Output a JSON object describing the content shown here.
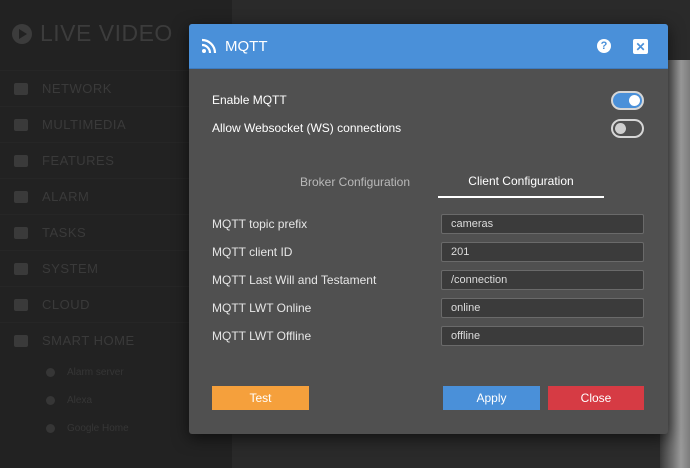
{
  "background": {
    "app_title": "LIVE VIDEO",
    "menu": [
      {
        "label": "NETWORK",
        "icon": "network-icon"
      },
      {
        "label": "MULTIMEDIA",
        "icon": "image-icon"
      },
      {
        "label": "FEATURES",
        "icon": "features-icon"
      },
      {
        "label": "ALARM",
        "icon": "bell-icon"
      },
      {
        "label": "TASKS",
        "icon": "tasks-icon"
      },
      {
        "label": "SYSTEM",
        "icon": "gear-icon"
      },
      {
        "label": "CLOUD",
        "icon": "cloud-icon"
      },
      {
        "label": "SMART HOME",
        "icon": "home-icon"
      }
    ],
    "submenu": [
      {
        "label": "Alarm server",
        "icon": "server-icon"
      },
      {
        "label": "Alexa",
        "icon": "alexa-icon"
      },
      {
        "label": "Google Home",
        "icon": "google-icon"
      }
    ]
  },
  "dialog": {
    "title": "MQTT",
    "header_icon": "rss-icon",
    "help_label": "?",
    "close_x_label": "✕",
    "toggles": [
      {
        "label": "Enable MQTT",
        "state": "on"
      },
      {
        "label": "Allow Websocket (WS) connections",
        "state": "off"
      }
    ],
    "tabs": [
      {
        "label": "Broker Configuration",
        "active": false
      },
      {
        "label": "Client Configuration",
        "active": true
      }
    ],
    "fields": [
      {
        "label": "MQTT topic prefix",
        "value": "cameras"
      },
      {
        "label": "MQTT client ID",
        "value": "201"
      },
      {
        "label": "MQTT Last Will and Testament",
        "value": "/connection"
      },
      {
        "label": "MQTT LWT Online",
        "value": "online"
      },
      {
        "label": "MQTT LWT Offline",
        "value": "offline"
      }
    ],
    "buttons": {
      "test": "Test",
      "apply": "Apply",
      "close": "Close"
    }
  },
  "colors": {
    "header_blue": "#4a90d9",
    "test_orange": "#f5a03c",
    "close_red": "#d63b44"
  }
}
